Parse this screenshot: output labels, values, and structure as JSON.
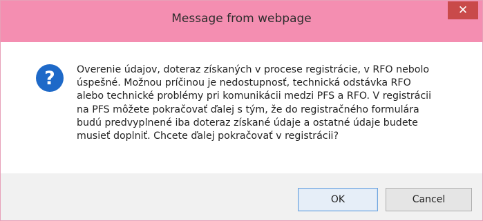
{
  "dialog": {
    "title": "Message from webpage",
    "close_glyph": "✕",
    "icon": "question-icon",
    "icon_glyph": "?",
    "message_lines": [
      "Overenie údajov, doteraz získaných v procese registrácie, v RFO nebolo",
      "úspešné. Možnou príčinou je nedostupnosť, technická odstávka RFO",
      "alebo technické problémy pri komunikácii medzi PFS a RFO. V registrácii",
      "na PFS môžete pokračovať ďalej s tým, že do registračného formulára",
      "budú predvyplnené iba doteraz získané údaje a ostatné údaje budete",
      "musieť doplniť. Chcete ďalej pokračovať v registrácii?"
    ],
    "ok_label": "OK",
    "cancel_label": "Cancel"
  },
  "colors": {
    "titlebar": "#f48eb1",
    "close_button": "#c94a4a",
    "icon_blue": "#1e69c8",
    "button_bar": "#f1f1f1"
  }
}
